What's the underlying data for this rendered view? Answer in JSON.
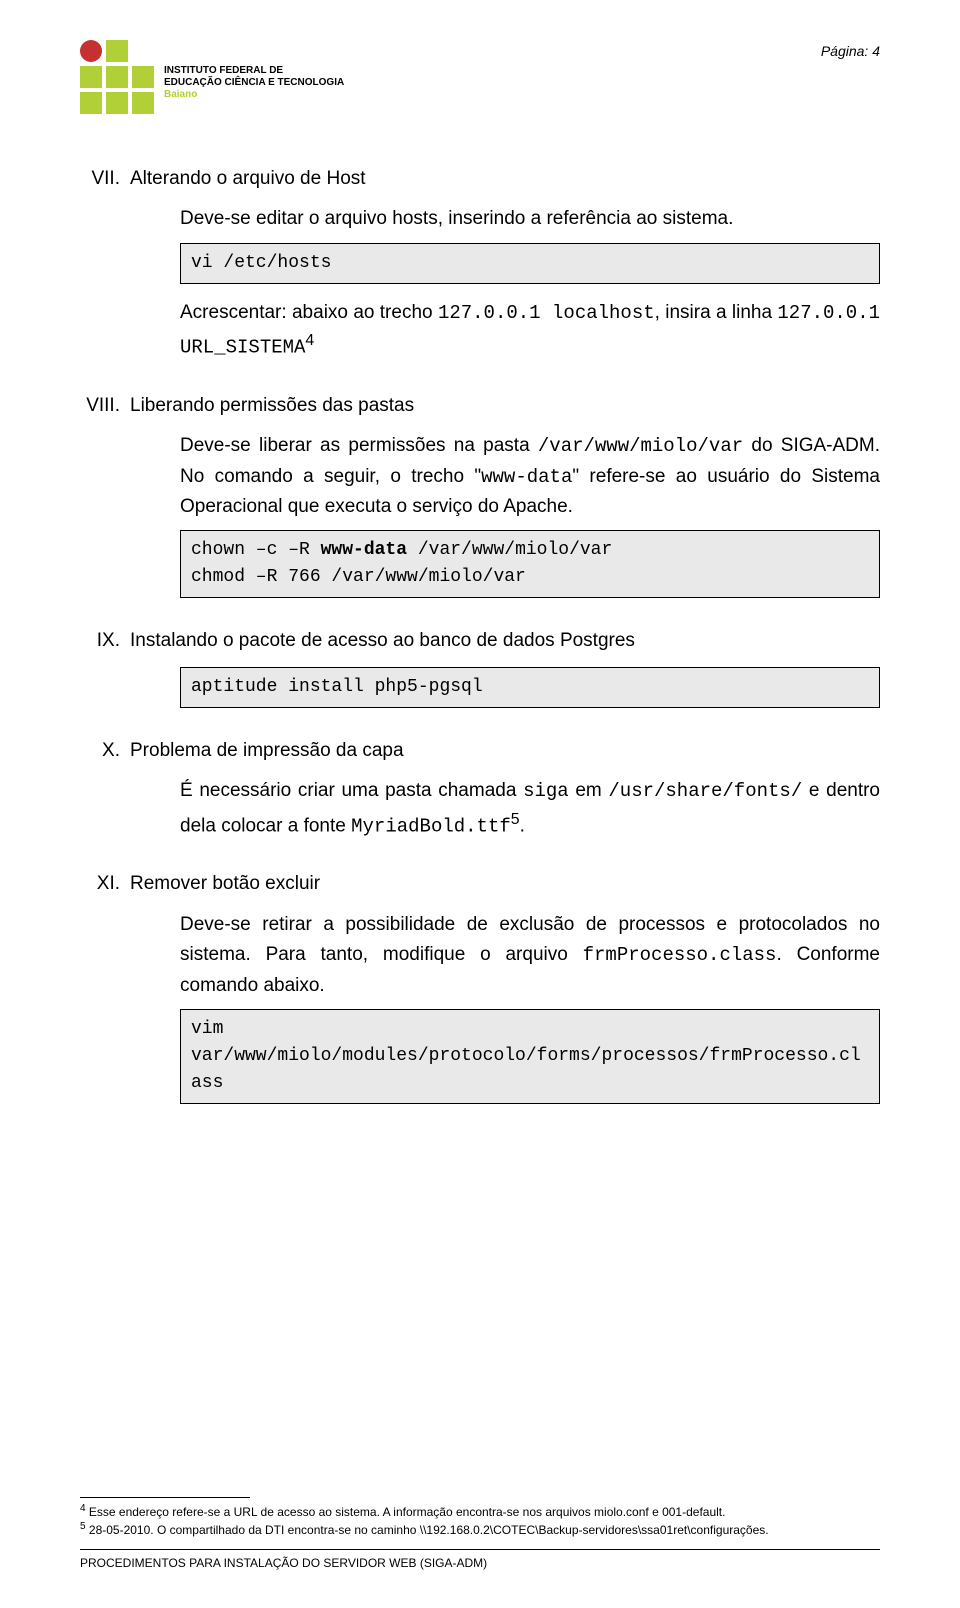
{
  "header": {
    "logo_line1": "INSTITUTO FEDERAL DE",
    "logo_line2": "EDUCAÇÃO CIÊNCIA E TECNOLOGIA",
    "logo_line3": "Baiano",
    "page_label": "Página: 4"
  },
  "sections": {
    "s7": {
      "roman": "VII.",
      "title": "Alterando o arquivo de Host",
      "p1": "Deve-se editar o arquivo hosts, inserindo a referência ao sistema.",
      "code1": "vi /etc/hosts",
      "p2a": "Acrescentar: abaixo ao trecho ",
      "p2_code1": "127.0.0.1 localhost",
      "p2b": ", insira a linha ",
      "p2_code2": "127.0.0.1 URL_SISTEMA",
      "p2_sup": "4"
    },
    "s8": {
      "roman": "VIII.",
      "title": "Liberando permissões das pastas",
      "p1a": "Deve-se liberar as permissões na pasta ",
      "p1_code1": "/var/www/miolo/var",
      "p1b": " do SIGA-ADM. No comando a seguir, o trecho \"",
      "p1_code2": "www-data",
      "p1c": "\" refere-se ao usuário do Sistema Operacional que executa o serviço do Apache.",
      "code1_pre": "chown –c –R ",
      "code1_bold": "www-data",
      "code1_post": " /var/www/miolo/var\nchmod –R 766 /var/www/miolo/var"
    },
    "s9": {
      "roman": "IX.",
      "title": "Instalando o pacote de acesso ao banco de dados Postgres",
      "code1": "aptitude install php5-pgsql"
    },
    "s10": {
      "roman": "X.",
      "title": "Problema de impressão da capa",
      "p1a": "É necessário criar uma pasta chamada ",
      "p1_code1": "siga",
      "p1b": " em ",
      "p1_code2": "/usr/share/fonts/",
      "p1c": " e dentro dela colocar a fonte ",
      "p1_code3": "MyriadBold.ttf",
      "p1_sup": "5",
      "p1d": "."
    },
    "s11": {
      "roman": "XI.",
      "title": "Remover botão excluir",
      "p1a": "Deve-se retirar a possibilidade de exclusão de processos e protocolados no sistema. Para tanto, modifique o arquivo ",
      "p1_code1": "frmProcesso.class",
      "p1b": ". Conforme comando abaixo.",
      "code1": "vim\nvar/www/miolo/modules/protocolo/forms/processos/frmProcesso.class"
    }
  },
  "footnotes": {
    "f4_num": "4",
    "f4_text": " Esse endereço refere-se a URL de acesso ao sistema. A informação encontra-se nos arquivos miolo.conf e 001-default.",
    "f5_num": "5",
    "f5_text": " 28-05-2010. O compartilhado da DTI encontra-se no caminho \\\\192.168.0.2\\COTEC\\Backup-servidores\\ssa01ret\\configurações."
  },
  "footer": {
    "text": "PROCEDIMENTOS PARA INSTALAÇÃO DO SERVIDOR WEB (SIGA-ADM)"
  }
}
